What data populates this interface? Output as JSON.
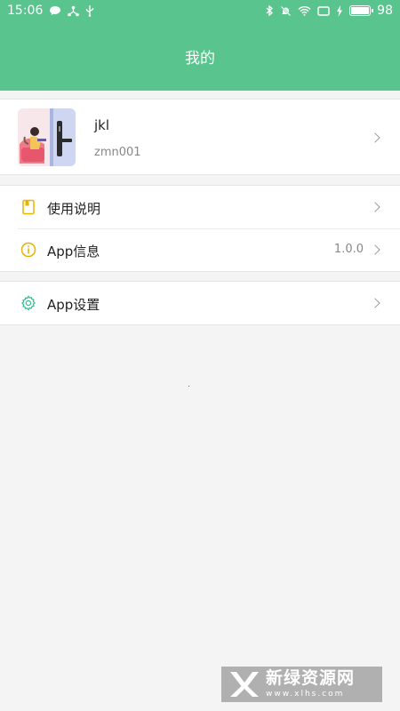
{
  "status_bar": {
    "time": "15:06",
    "battery": "98",
    "battery_level": 0.98
  },
  "header": {
    "title": "我的"
  },
  "profile": {
    "name": "jkl",
    "username": "zmn001"
  },
  "menu": {
    "group1": [
      {
        "label": "使用说明",
        "icon": "book-icon"
      },
      {
        "label": "App信息",
        "value": "1.0.0",
        "icon": "info-icon"
      }
    ],
    "group2": [
      {
        "label": "App设置",
        "icon": "gear-icon"
      }
    ]
  },
  "watermark": {
    "title": "新绿资源网",
    "subtitle": "www.xlhs.com"
  },
  "colors": {
    "accent": "#5ac48e",
    "icon_yellow": "#e9b400",
    "icon_teal": "#3dbd95"
  }
}
